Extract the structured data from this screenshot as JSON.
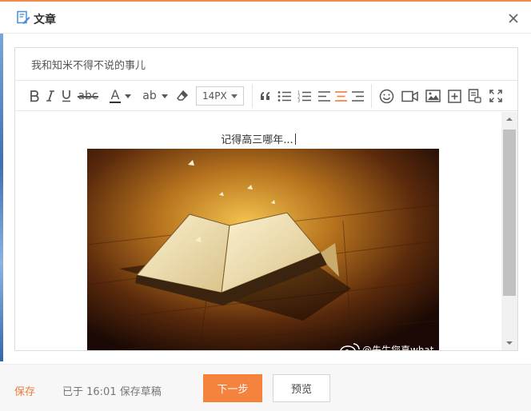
{
  "window": {
    "title": "文章",
    "title_icon": "edit-document-icon",
    "close_icon": "close-icon",
    "accent_color": "#f5823d"
  },
  "editor": {
    "title_value": "我和知米不得不说的事儿",
    "toolbar": {
      "font_size": "14PX",
      "strikethrough_label": "abc",
      "font_color_label": "A",
      "highlight_label": "ab",
      "icons": [
        "bold-icon",
        "italic-icon",
        "underline-icon",
        "strikethrough-icon",
        "font-color-icon",
        "highlight-icon",
        "eraser-icon",
        "font-size-select",
        "quote-icon",
        "bullet-list-icon",
        "numbered-list-icon",
        "align-left-icon",
        "align-center-icon",
        "align-right-icon",
        "emoji-icon",
        "video-icon",
        "image-icon",
        "insert-icon",
        "attachment-icon",
        "fullscreen-icon"
      ]
    },
    "content": {
      "caption": "记得高三哪年...",
      "watermark": "@先生您真what"
    }
  },
  "footer": {
    "save_label": "保存",
    "save_status": "已于 16:01 保存草稿",
    "next_label": "下一步",
    "preview_label": "预览"
  }
}
